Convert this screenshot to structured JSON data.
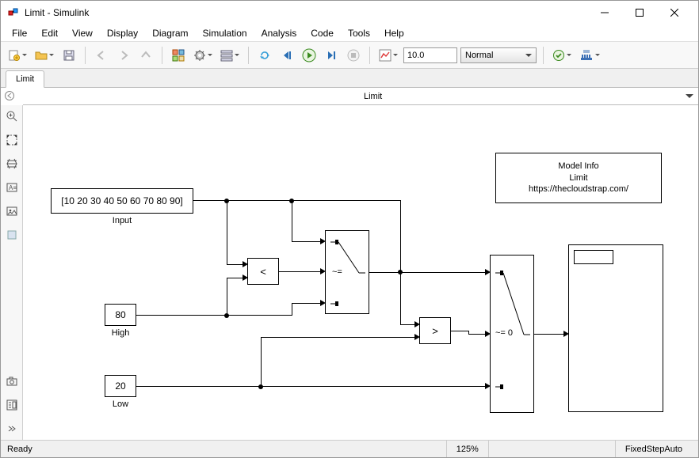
{
  "window": {
    "title": "Limit - Simulink"
  },
  "menu": [
    "File",
    "Edit",
    "View",
    "Display",
    "Diagram",
    "Simulation",
    "Analysis",
    "Code",
    "Tools",
    "Help"
  ],
  "toolbar": {
    "sim_time": "10.0",
    "sim_mode": "Normal"
  },
  "tab": {
    "label": "Limit"
  },
  "crumb": {
    "label": "Limit"
  },
  "blocks": {
    "input": {
      "value": "[10 20 30 40 50 60 70 80 90]",
      "label": "Input"
    },
    "high": {
      "value": "80",
      "label": "High"
    },
    "low": {
      "value": "20",
      "label": "Low"
    },
    "less": "<",
    "greater": ">",
    "switch1": "~=",
    "switch2": "~= 0"
  },
  "modelinfo": {
    "l1": "Model Info",
    "l2": "Limit",
    "l3": "https://thecloudstrap.com/"
  },
  "status": {
    "ready": "Ready",
    "zoom": "125%",
    "solver": "FixedStepAuto"
  }
}
